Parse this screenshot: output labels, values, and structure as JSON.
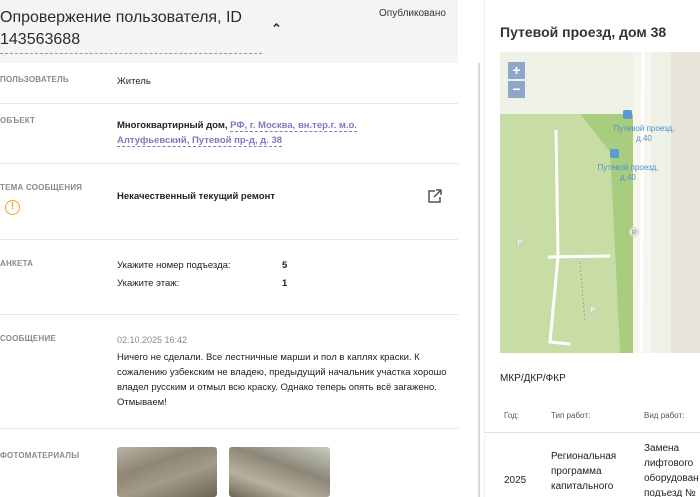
{
  "header": {
    "title": "Опровержение пользователя, ID 143563688",
    "status": "Опубликовано"
  },
  "fields": {
    "user_label": "ПОЛЬЗОВАТЕЛЬ",
    "user_value": "Житель",
    "object_label": "ОБЪЕКТ",
    "object_type": "Многоквартирный дом,",
    "object_address_line1": "РФ, г. Москва, вн.тер.г. м.о.",
    "object_address_line2": "Алтуфьевский, Путевой пр-д, д. 38",
    "topic_label": "ТЕМА СООБЩЕНИЯ",
    "topic_value": "Некачественный текущий ремонт",
    "form_label": "АНКЕТА",
    "form_q1": "Укажите номер подъезда:",
    "form_a1": "5",
    "form_q2": "Укажите этаж:",
    "form_a2": "1",
    "message_label": "СООБЩЕНИЕ",
    "message_date": "02.10.2025 16:42",
    "message_text": "Ничего не сделали. Все лестничные марши и пол в каплях краски. К сожалению узбекским не владею, предыдущий начальник участка хорошо владел русским и отмыл всю краску. Однако теперь опять всё загажено. Отмываем!",
    "photos_label": "ФОТОМАТЕРИАЛЫ"
  },
  "map_panel": {
    "title": "Путевой проезд, дом 38",
    "zoom_in": "+",
    "zoom_out": "−",
    "bus_stop_label": "Путевой проезд, д.40",
    "section_title": "МКР/ДКР/ФКР",
    "table_headers": [
      "Год:",
      "Тип работ:",
      "Вид работ:"
    ],
    "row_year": "2025",
    "row_type": "Региональная программа капитального",
    "row_kind": "Замена лифтового оборудован подъезд №"
  },
  "colors": {
    "link": "#7b7bbf",
    "warning": "#f0a020",
    "header_bg": "#f4f4f4"
  }
}
